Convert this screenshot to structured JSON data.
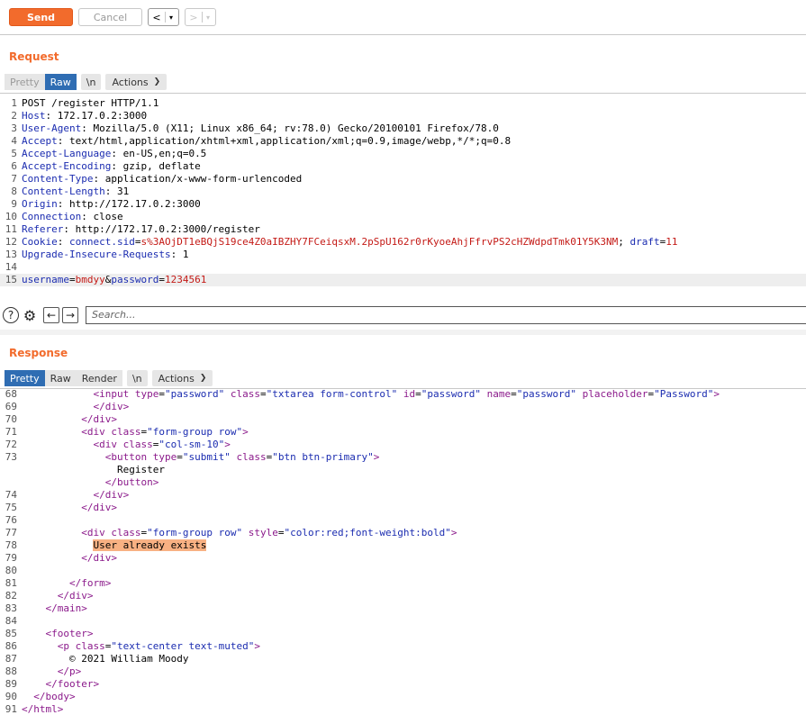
{
  "toolbar": {
    "send_label": "Send",
    "cancel_label": "Cancel",
    "back_glyph": "<",
    "forward_glyph": ">",
    "dropdown_glyph": "▾"
  },
  "request": {
    "title": "Request",
    "tabs": {
      "pretty": "Pretty",
      "raw": "Raw",
      "newline": "\\n",
      "actions": "Actions"
    },
    "lines": [
      {
        "n": "1",
        "key": "POST /register HTTP/1.1",
        "val": ""
      },
      {
        "n": "2",
        "key": "Host",
        "val": "172.17.0.2:3000"
      },
      {
        "n": "3",
        "key": "User-Agent",
        "val": "Mozilla/5.0 (X11; Linux x86_64; rv:78.0) Gecko/20100101 Firefox/78.0"
      },
      {
        "n": "4",
        "key": "Accept",
        "val": "text/html,application/xhtml+xml,application/xml;q=0.9,image/webp,*/*;q=0.8"
      },
      {
        "n": "5",
        "key": "Accept-Language",
        "val": "en-US,en;q=0.5"
      },
      {
        "n": "6",
        "key": "Accept-Encoding",
        "val": "gzip, deflate"
      },
      {
        "n": "7",
        "key": "Content-Type",
        "val": "application/x-www-form-urlencoded"
      },
      {
        "n": "8",
        "key": "Content-Length",
        "val": "31"
      },
      {
        "n": "9",
        "key": "Origin",
        "val": "http://172.17.0.2:3000"
      },
      {
        "n": "10",
        "key": "Connection",
        "val": "close"
      },
      {
        "n": "11",
        "key": "Referer",
        "val": "http://172.17.0.2:3000/register"
      },
      {
        "n": "12",
        "key": "Cookie",
        "cookie_name": "connect.sid",
        "cookie_val": "s%3AOjDT1eBQjS19ce4Z0aIBZHY7FCeiqsxM.2pSpU162r0rKyoeAhjFfrvPS2cHZWdpdTmk01Y5K3NM",
        "cookie2_name": "draft",
        "cookie2_val": "11"
      },
      {
        "n": "13",
        "key": "Upgrade-Insecure-Requests",
        "val": "1"
      },
      {
        "n": "14",
        "key": "",
        "val": ""
      },
      {
        "n": "15",
        "p1k": "username",
        "p1v": "bmdyy",
        "p2k": "password",
        "p2v": "1234561"
      }
    ]
  },
  "search": {
    "placeholder": "Search..."
  },
  "response": {
    "title": "Response",
    "tabs": {
      "pretty": "Pretty",
      "raw": "Raw",
      "render": "Render",
      "newline": "\\n",
      "actions": "Actions"
    },
    "lines": {
      "l68": {
        "n": "68",
        "tag": "input",
        "a1": "type",
        "v1": "\"password\"",
        "a2": "class",
        "v2": "\"txtarea form-control\"",
        "a3": "id",
        "v3": "\"password\"",
        "a4": "name",
        "v4": "\"password\"",
        "a5": "placeholder",
        "v5": "\"Password\""
      },
      "l69": {
        "n": "69",
        "tag": "div"
      },
      "l70": {
        "n": "70",
        "tag": "div"
      },
      "l71": {
        "n": "71",
        "tag": "div",
        "a1": "class",
        "v1": "\"form-group row\""
      },
      "l72": {
        "n": "72",
        "tag": "div",
        "a1": "class",
        "v1": "\"col-sm-10\""
      },
      "l73": {
        "n": "73",
        "tag": "button",
        "a1": "type",
        "v1": "\"submit\"",
        "a2": "class",
        "v2": "\"btn btn-primary\""
      },
      "l73b": {
        "text": "Register"
      },
      "l73c": {
        "tag": "button"
      },
      "l74": {
        "n": "74",
        "tag": "div"
      },
      "l75": {
        "n": "75",
        "tag": "div"
      },
      "l76": {
        "n": "76"
      },
      "l77": {
        "n": "77",
        "tag": "div",
        "a1": "class",
        "v1": "\"form-group row\"",
        "a2": "style",
        "v2": "\"color:red;font-weight:bold\""
      },
      "l78": {
        "n": "78",
        "text": "User already exists"
      },
      "l79": {
        "n": "79",
        "tag": "div"
      },
      "l80": {
        "n": "80"
      },
      "l81": {
        "n": "81",
        "tag": "form"
      },
      "l82": {
        "n": "82",
        "tag": "div"
      },
      "l83": {
        "n": "83",
        "tag": "main"
      },
      "l84": {
        "n": "84"
      },
      "l85": {
        "n": "85",
        "tag": "footer"
      },
      "l86": {
        "n": "86",
        "tag": "p",
        "a1": "class",
        "v1": "\"text-center text-muted\""
      },
      "l87": {
        "n": "87",
        "text": "© 2021 William Moody"
      },
      "l88": {
        "n": "88",
        "tag": "p"
      },
      "l89": {
        "n": "89",
        "tag": "footer"
      },
      "l90": {
        "n": "90",
        "tag": "body"
      },
      "l91": {
        "n": "91",
        "tag": "html"
      }
    }
  }
}
